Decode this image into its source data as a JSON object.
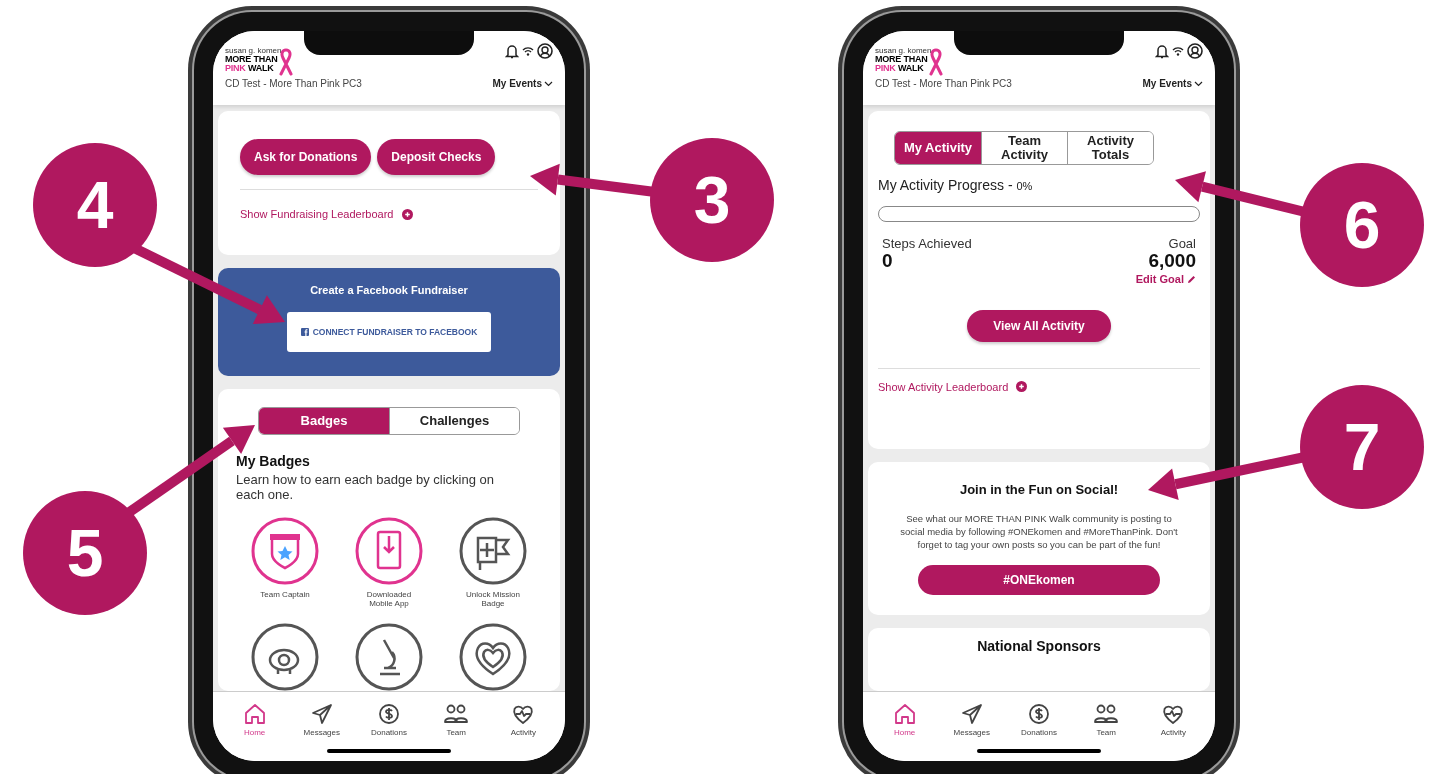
{
  "phones": [
    {
      "header": {
        "brand_line": "susan g. komen",
        "logo_line_1": "MORE THAN",
        "logo_pink": "PINK",
        "logo_walk": "WALK",
        "event": "CD Test - More Than Pink PC3",
        "events_menu": "My Events"
      },
      "sections": [
        {
          "kind": "actions",
          "buttons": [
            "Ask for Donations",
            "Deposit Checks"
          ],
          "link": "Show Fundraising Leaderboard"
        },
        {
          "kind": "facebook",
          "title": "Create a Facebook Fundraiser",
          "button": "CONNECT FUNDRAISER TO FACEBOOK"
        },
        {
          "kind": "badges",
          "tabs": [
            {
              "label": "Badges",
              "selected": true
            },
            {
              "label": "Challenges",
              "selected": false
            }
          ],
          "heading": "My Badges",
          "description": "Learn how to earn each badge by clicking on each one.",
          "items": [
            {
              "label": "Team Captain",
              "earned": true
            },
            {
              "label": "Downloaded Mobile App",
              "earned": true
            },
            {
              "label": "Unlock Mission Badge",
              "earned": false
            },
            {
              "earned": false
            },
            {
              "earned": false
            },
            {
              "earned": false
            }
          ]
        }
      ],
      "nav": [
        {
          "label": "Home",
          "selected": true
        },
        {
          "label": "Messages",
          "selected": false
        },
        {
          "label": "Donations",
          "selected": false
        },
        {
          "label": "Team",
          "selected": false
        },
        {
          "label": "Activity",
          "selected": false
        }
      ]
    },
    {
      "header": {
        "brand_line": "susan g. komen",
        "logo_line_1": "MORE THAN",
        "logo_pink": "PINK",
        "logo_walk": "WALK",
        "event": "CD Test - More Than Pink PC3",
        "events_menu": "My Events"
      },
      "sections": [
        {
          "kind": "activity",
          "tabs": [
            {
              "label": "My Activity",
              "selected": true
            },
            {
              "label": "Team Activity",
              "selected": false
            },
            {
              "label": "Activity Totals",
              "selected": false
            }
          ],
          "progress_label": "My Activity Progress - ",
          "progress_value": "0%",
          "level": 0,
          "steps_label": "Steps Achieved",
          "steps": "0",
          "goal_label": "Goal",
          "goal": "6,000",
          "edit_goal": "Edit Goal",
          "button": "View All Activity",
          "link": "Show Activity Leaderboard"
        },
        {
          "kind": "social",
          "title": "Join in the Fun on Social!",
          "text": "See what our MORE THAN PINK Walk community is posting to social media by following #ONEkomen and #MoreThanPink. Don't forget to tag your own posts so you can be part of the fun!",
          "button": "#ONEkomen"
        },
        {
          "kind": "sponsors",
          "title": "National Sponsors"
        }
      ],
      "nav": [
        {
          "label": "Home",
          "selected": true
        },
        {
          "label": "Messages",
          "selected": false
        },
        {
          "label": "Donations",
          "selected": false
        },
        {
          "label": "Team",
          "selected": false
        },
        {
          "label": "Activity",
          "selected": false
        }
      ]
    }
  ],
  "callouts": [
    {
      "number": "4"
    },
    {
      "number": "3"
    },
    {
      "number": "6"
    },
    {
      "number": "7"
    },
    {
      "number": "5"
    }
  ]
}
